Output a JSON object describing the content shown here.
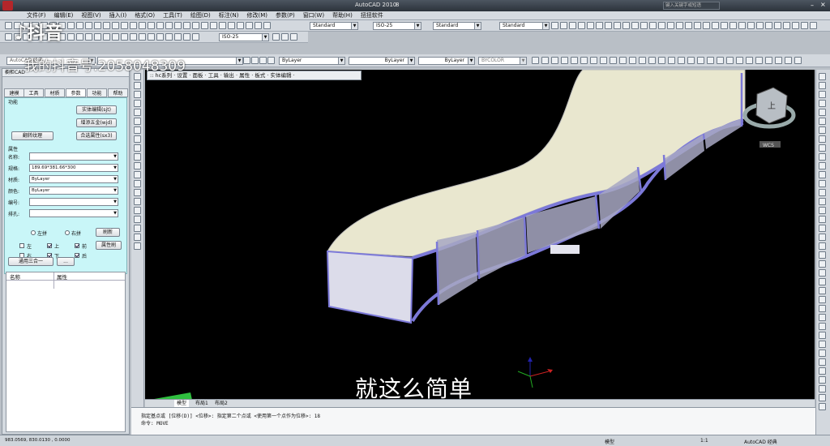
{
  "app": {
    "title": "AutoCAD 2010",
    "window_suffix": "8",
    "search_placeholder": "键入关键字或短语"
  },
  "menu": [
    "文件(F)",
    "编辑(E)",
    "视图(V)",
    "插入(I)",
    "格式(O)",
    "工具(T)",
    "绘图(D)",
    "标注(N)",
    "修改(M)",
    "参数(P)",
    "窗口(W)",
    "帮助(H)",
    "扭扭软件"
  ],
  "styles": {
    "text_style": "Standard",
    "dim_style": "ISO-25",
    "table_style": "Standard",
    "multileader_style": "Standard",
    "dim_style2": "ISO-25"
  },
  "layer": {
    "workspace": "AutoCAD 经典",
    "color": "ByLayer",
    "linetype": "ByLayer",
    "lineweight": "ByLayer",
    "plot_style": "BYCOLOR"
  },
  "panel": {
    "title": "橱柜CAD",
    "tabs": [
      "建模",
      "工具",
      "材质",
      "参数",
      "功能",
      "帮助"
    ],
    "active_tab": "参数",
    "function_label": "功能",
    "buttons": {
      "solid_edit": "实体编辑(sjt)",
      "add_hardware": "增添五金(wjd)",
      "merge_props": "合选属性(sx3)",
      "flip_texture": "翻转纹理",
      "refresh": "刷新",
      "prop_brush": "属性刷",
      "three_in_one": "通用三合一",
      "more": "..."
    },
    "props_label": "属性",
    "fields": [
      {
        "label": "名称:",
        "value": ""
      },
      {
        "label": "规格:",
        "value": "189.69*381.66*300"
      },
      {
        "label": "材质:",
        "value": "ByLayer"
      },
      {
        "label": "颜色:",
        "value": "ByLayer"
      },
      {
        "label": "编号:",
        "value": ""
      },
      {
        "label": "排孔:",
        "value": ""
      }
    ],
    "radios": [
      "左拼",
      "右拼"
    ],
    "checks": [
      {
        "label": "左",
        "checked": false
      },
      {
        "label": "上",
        "checked": true
      },
      {
        "label": "前",
        "checked": true
      },
      {
        "label": "右",
        "checked": false
      },
      {
        "label": "下",
        "checked": true
      },
      {
        "label": "后",
        "checked": true
      }
    ],
    "table_headers": [
      "名称",
      "属性"
    ]
  },
  "ribbon": ":: hc系列 · 设置 · 面板 · 工具 · 输出 · 属性 · 板式 · 实体编辑 ·",
  "viewcube": {
    "face": "上",
    "wcs": "WCS"
  },
  "layout_tabs": [
    "模型",
    "布局1",
    "布局2"
  ],
  "command": {
    "line1": "指定基点或 [位移(D)] <位移>:  指定第二个点或 <使用第一个点作为位移>: 18",
    "line2": "命令:  MOVE"
  },
  "status": {
    "coords": "983.0569,  830.0130 , 0.0000",
    "model": "模型",
    "scale": "1:1",
    "workspace": "AutoCAD 经典"
  },
  "overlay": {
    "tiktok": "抖音",
    "watermark": "我的抖音号:2058048309",
    "subtitle": "就这么简单"
  }
}
